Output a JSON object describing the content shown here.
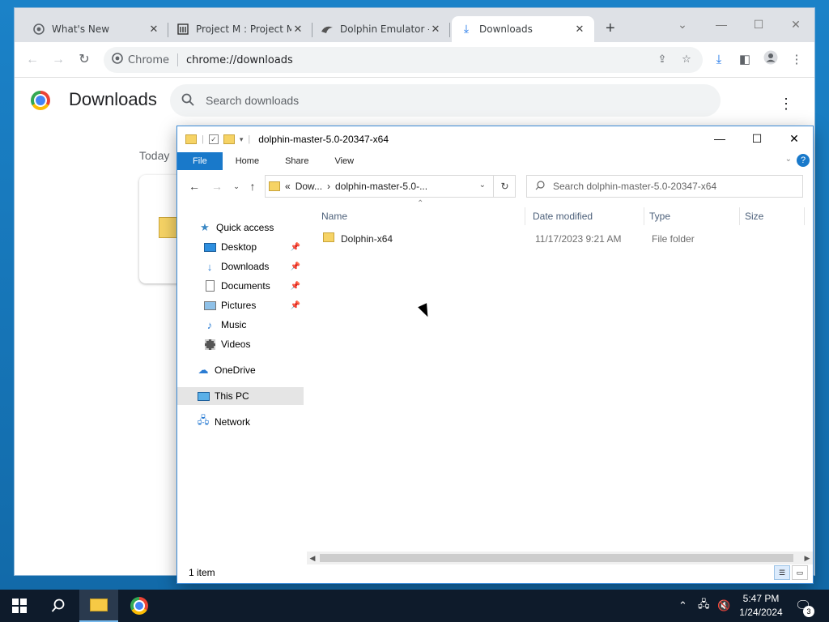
{
  "chrome": {
    "tabs": [
      {
        "title": "What's New",
        "icon": "chrome-icon"
      },
      {
        "title": "Project M : Project M",
        "icon": "archive-icon"
      },
      {
        "title": "Dolphin Emulator - D",
        "icon": "dolphin-icon"
      },
      {
        "title": "Downloads",
        "icon": "download-icon",
        "active": true
      }
    ],
    "omnibox_label": "Chrome",
    "url": "chrome://downloads",
    "page_title": "Downloads",
    "search_placeholder": "Search downloads",
    "today_label": "Today"
  },
  "explorer": {
    "title": "dolphin-master-5.0-20347-x64",
    "ribbon_tabs": [
      "File",
      "Home",
      "Share",
      "View"
    ],
    "breadcrumb": [
      "Dow...",
      "dolphin-master-5.0-..."
    ],
    "breadcrumb_prefix": "«",
    "search_placeholder": "Search dolphin-master-5.0-20347-x64",
    "nav": {
      "quick_access": "Quick access",
      "items": [
        {
          "label": "Desktop",
          "icon": "desktop-icon",
          "pinned": true
        },
        {
          "label": "Downloads",
          "icon": "downloads-icon",
          "pinned": true
        },
        {
          "label": "Documents",
          "icon": "documents-icon",
          "pinned": true
        },
        {
          "label": "Pictures",
          "icon": "pictures-icon",
          "pinned": true
        },
        {
          "label": "Music",
          "icon": "music-icon",
          "pinned": false
        },
        {
          "label": "Videos",
          "icon": "videos-icon",
          "pinned": false
        }
      ],
      "onedrive": "OneDrive",
      "this_pc": "This PC",
      "network": "Network"
    },
    "columns": [
      "Name",
      "Date modified",
      "Type",
      "Size"
    ],
    "files": [
      {
        "name": "Dolphin-x64",
        "date": "11/17/2023 9:21 AM",
        "type": "File folder",
        "size": ""
      }
    ],
    "status": "1 item"
  },
  "taskbar": {
    "time": "5:47 PM",
    "date": "1/24/2024",
    "notification_count": "3"
  },
  "colors": {
    "accent": "#1979ca",
    "desktop": "#1a73b8",
    "taskbar": "#0e1b2b"
  }
}
